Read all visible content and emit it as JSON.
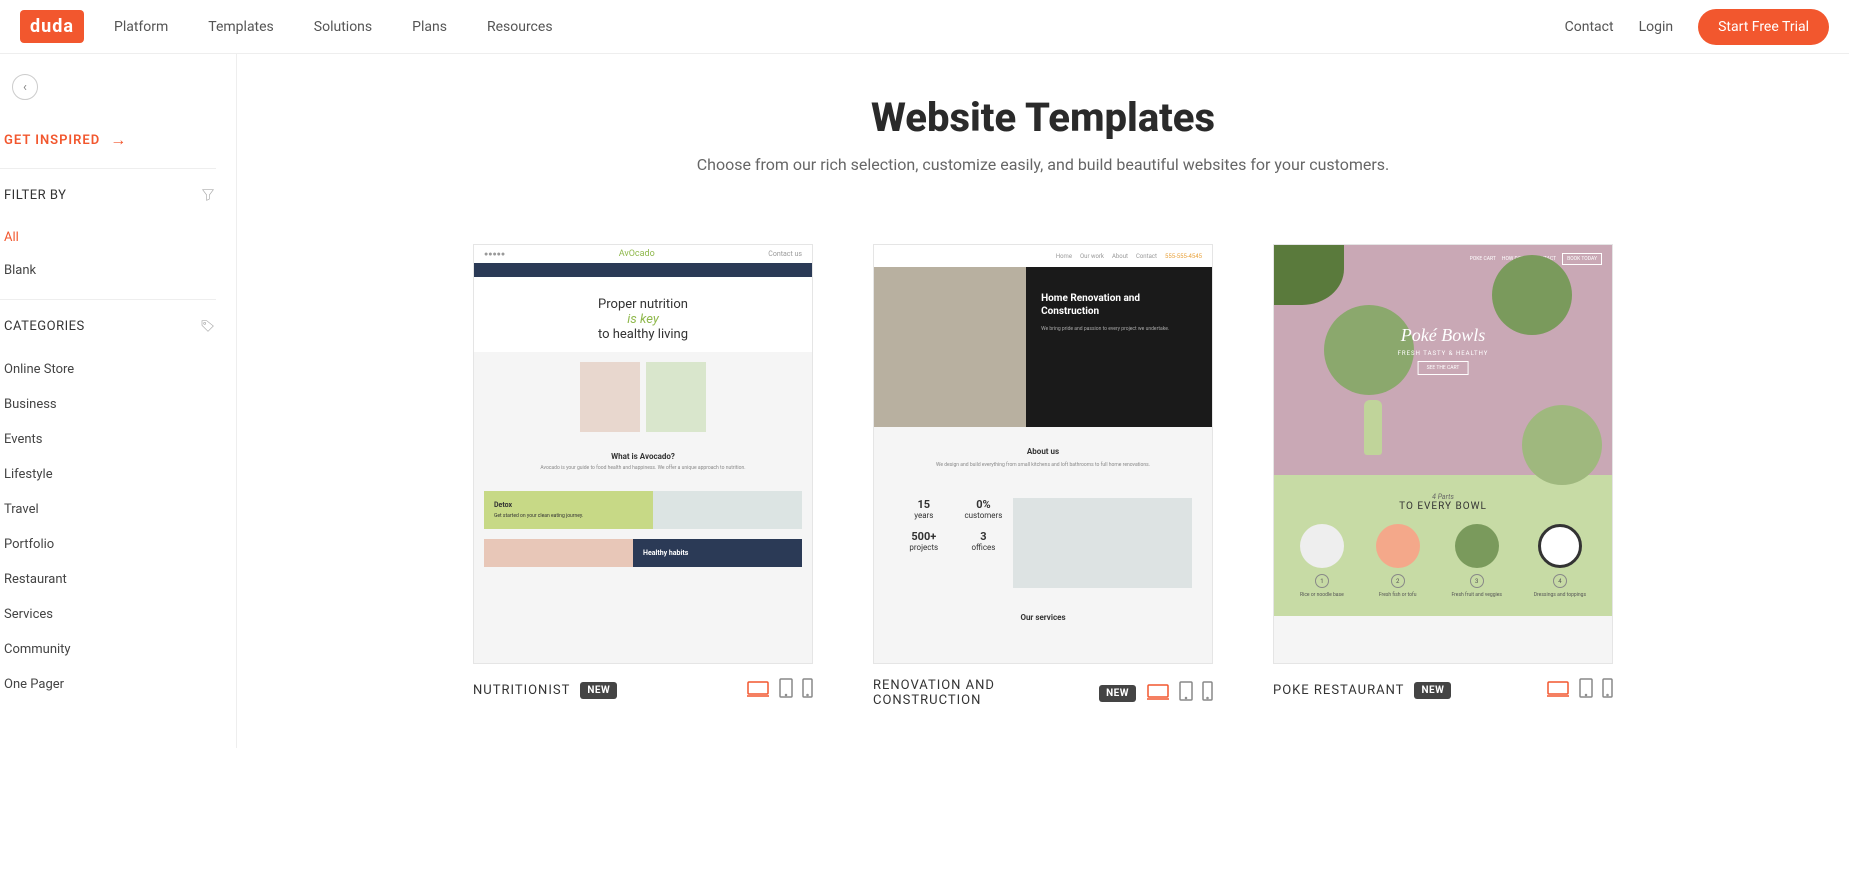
{
  "header": {
    "logo": "duda",
    "nav": [
      "Platform",
      "Templates",
      "Solutions",
      "Plans",
      "Resources"
    ],
    "contact": "Contact",
    "login": "Login",
    "trial": "Start Free Trial"
  },
  "sidebar": {
    "inspired": "GET INSPIRED",
    "filter_by": "FILTER BY",
    "filters": [
      "All",
      "Blank"
    ],
    "filter_active": "All",
    "categories_label": "CATEGORIES",
    "categories": [
      "Online Store",
      "Business",
      "Events",
      "Lifestyle",
      "Travel",
      "Portfolio",
      "Restaurant",
      "Services",
      "Community",
      "One Pager"
    ]
  },
  "main": {
    "title": "Website Templates",
    "subtitle": "Choose from our rich selection, customize easily, and build beautiful websites for your customers."
  },
  "cards": [
    {
      "title": "NUTRITIONIST",
      "badge": "NEW"
    },
    {
      "title": "RENOVATION AND CONSTRUCTION",
      "badge": "NEW"
    },
    {
      "title": "POKE RESTAURANT",
      "badge": "NEW"
    }
  ],
  "mock1": {
    "brand": "AvOcado",
    "hero1": "Proper nutrition",
    "hero2": "is key",
    "hero3": "to healthy living",
    "about_h": "What is Avocado?",
    "detox": "Detox",
    "habits": "Healthy habits"
  },
  "mock2": {
    "hero_h": "Home Renovation and Construction",
    "about_h": "About us",
    "stats": [
      {
        "n": "15",
        "l": "years"
      },
      {
        "n": "0%",
        "l": "customers"
      },
      {
        "n": "500+",
        "l": "projects"
      },
      {
        "n": "3",
        "l": "offices"
      }
    ],
    "services": "Our services"
  },
  "mock3": {
    "hero_h": "Poké Bowls",
    "hero_s": "FRESH TASTY & HEALTHY",
    "hero_b": "SEE THE CART",
    "btn": "BOOK TODAY",
    "lower_h1": "4 Parts",
    "lower_h2": "TO EVERY BOWL",
    "items": [
      {
        "n": "1",
        "l": "Rice or noodle base"
      },
      {
        "n": "2",
        "l": "Fresh fish or tofu"
      },
      {
        "n": "3",
        "l": "Fresh fruit and veggies"
      },
      {
        "n": "4",
        "l": "Dressings and toppings"
      }
    ]
  }
}
